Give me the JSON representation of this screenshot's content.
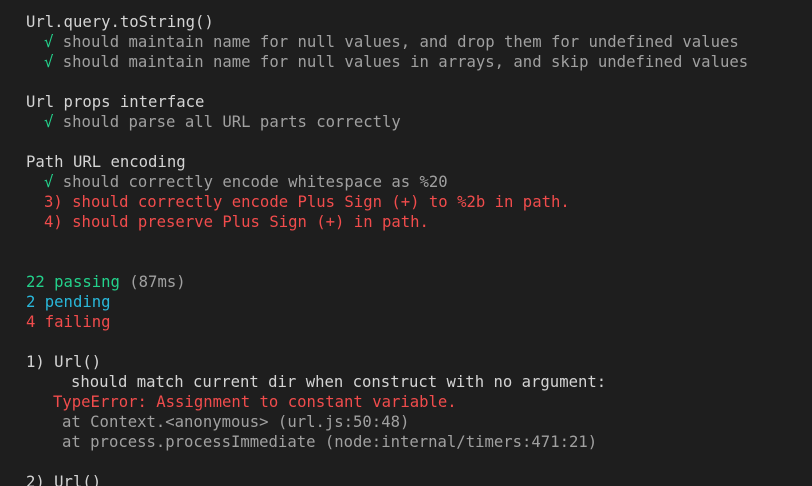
{
  "suites": [
    {
      "title": "Url.query.toString()",
      "tests": [
        "should maintain name for null values, and drop them for undefined values",
        "should maintain name for null values in arrays, and skip undefined values"
      ]
    },
    {
      "title": "Url props interface",
      "tests": [
        "should parse all URL parts correctly"
      ]
    },
    {
      "title": "Path URL encoding",
      "tests": [
        "should correctly encode whitespace as %20"
      ],
      "failed": [
        "3) should correctly encode Plus Sign (+) to %2b in path.",
        "4) should preserve Plus Sign (+) in path."
      ]
    }
  ],
  "check_mark": "√",
  "summary": {
    "passing": "22 passing",
    "time": "(87ms)",
    "pending": "2 pending",
    "failing": "4 failing"
  },
  "failures": [
    {
      "header": "1) Url()",
      "title": "should match current dir when construct with no argument:",
      "error": "TypeError: Assignment to constant variable.",
      "stack": [
        "at Context.<anonymous> (url.js:50:48)",
        "at process.processImmediate (node:internal/timers:471:21)"
      ]
    },
    {
      "header": "2) Url()"
    }
  ]
}
